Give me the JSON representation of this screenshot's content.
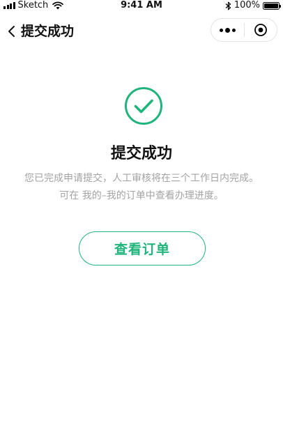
{
  "status_bar": {
    "carrier": "Sketch",
    "time": "9:41 AM",
    "battery": "100%",
    "battery_level": 1.0
  },
  "nav": {
    "title": "提交成功",
    "back_icon": "chevron-left-icon",
    "more_icon": "more-dots-icon",
    "close_icon": "target-icon"
  },
  "result": {
    "icon": "check-circle-icon",
    "title": "提交成功",
    "desc_line1": "您已完成申请提交，人工审核将在三个工作日内完成。",
    "desc_line2": "可在 我的–我的订单中查看办理进度。",
    "button_label": "查看订单"
  },
  "colors": {
    "accent": "#1fb47b",
    "muted_text": "#a3a3a3",
    "title_text": "#111111"
  }
}
